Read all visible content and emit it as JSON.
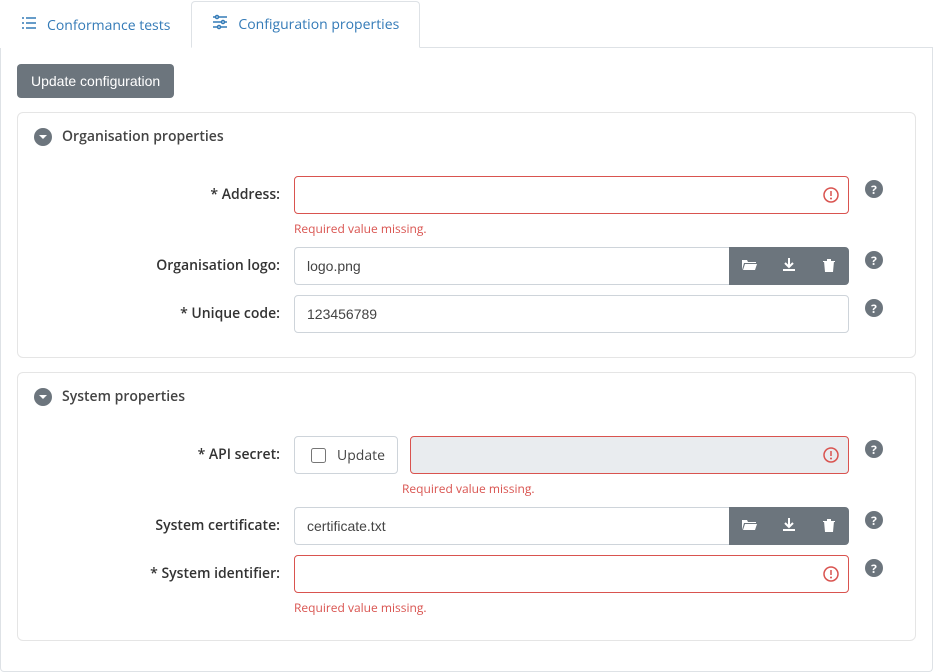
{
  "tabs": {
    "conformance": "Conformance tests",
    "configuration": "Configuration properties"
  },
  "update_btn": "Update configuration",
  "errors": {
    "required": "Required value missing."
  },
  "help_glyph": "?",
  "org": {
    "title": "Organisation properties",
    "address": {
      "label": "* Address:",
      "value": ""
    },
    "logo": {
      "label": "Organisation logo:",
      "value": "logo.png"
    },
    "code": {
      "label": "* Unique code:",
      "value": "123456789"
    }
  },
  "sys": {
    "title": "System properties",
    "api_secret": {
      "label": "* API secret:",
      "update_label": "Update",
      "value": ""
    },
    "cert": {
      "label": "System certificate:",
      "value": "certificate.txt"
    },
    "ident": {
      "label": "* System identifier:",
      "value": ""
    }
  }
}
